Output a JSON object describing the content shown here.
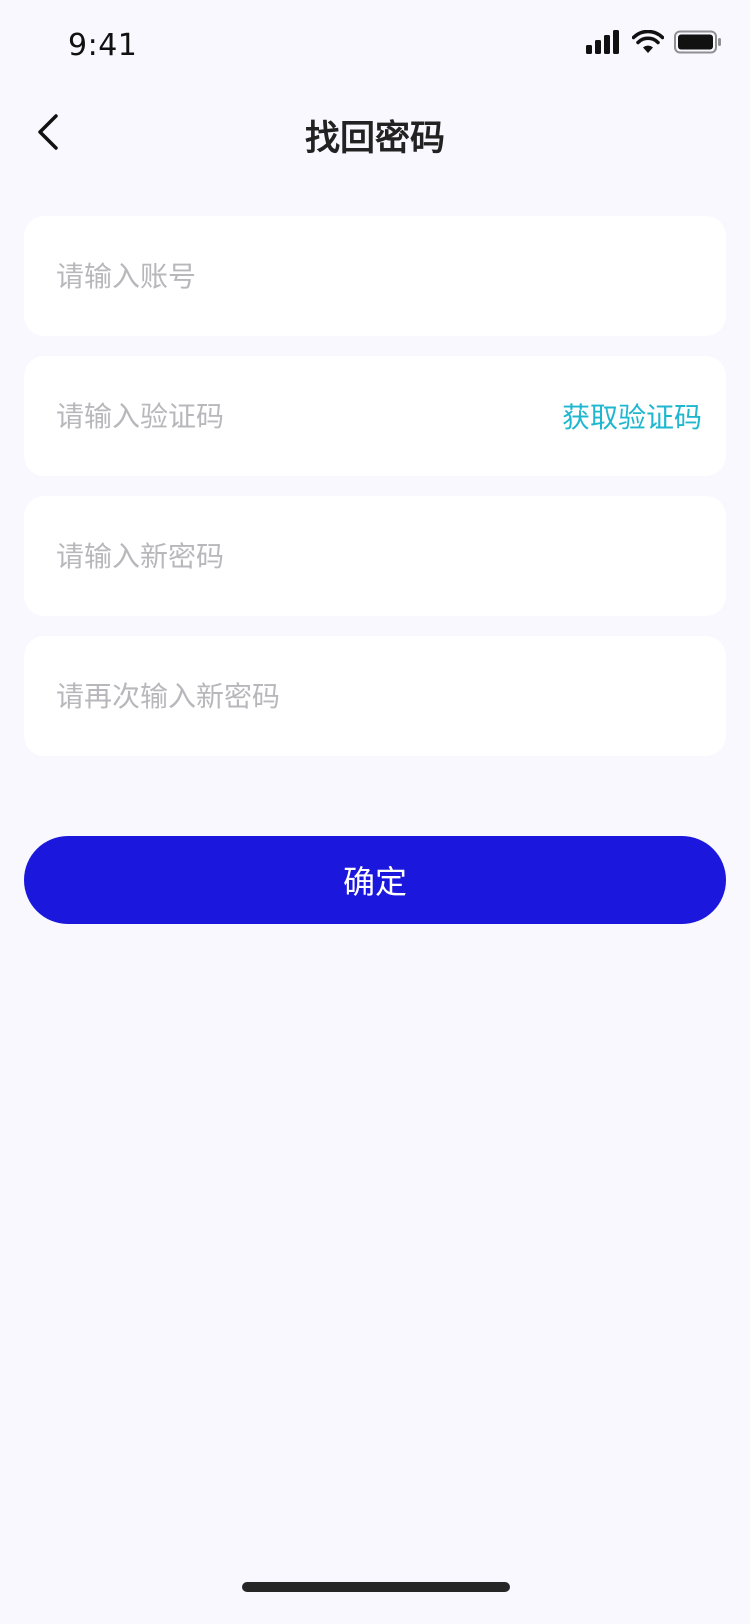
{
  "status_bar": {
    "time": "9:41"
  },
  "nav": {
    "title": "找回密码",
    "back_icon": "chevron-left-icon"
  },
  "form": {
    "account": {
      "placeholder": "请输入账号",
      "value": ""
    },
    "code": {
      "placeholder": "请输入验证码",
      "value": "",
      "action_label": "获取验证码"
    },
    "new_password": {
      "placeholder": "请输入新密码",
      "value": ""
    },
    "confirm_password": {
      "placeholder": "请再次输入新密码",
      "value": ""
    }
  },
  "confirm_button": {
    "label": "确定"
  },
  "colors": {
    "background": "#f8f8fe",
    "accent": "#1b17dc",
    "link": "#1fb7d0",
    "placeholder": "#b8b8bc"
  }
}
